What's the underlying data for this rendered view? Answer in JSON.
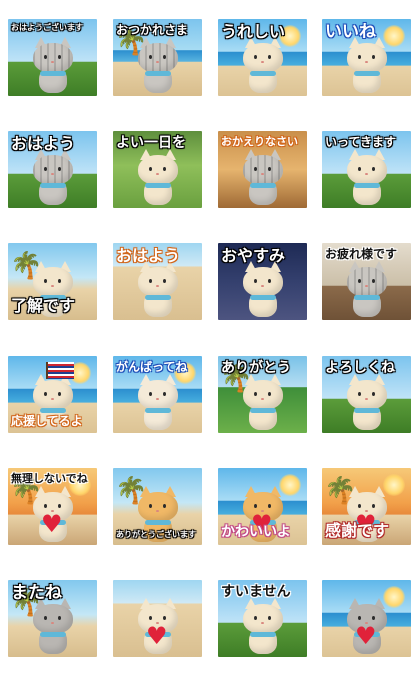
{
  "stickers": [
    {
      "label": "おはようございます",
      "scene": "grass",
      "cat": "gray-tabby",
      "style": "w"
    },
    {
      "label": "おつかれさま",
      "scene": "beach",
      "cat": "gray-tabby",
      "style": "w"
    },
    {
      "label": "うれしい",
      "scene": "sea",
      "cat": "cream",
      "style": "w"
    },
    {
      "label": "いいね",
      "scene": "sea",
      "cat": "cream",
      "style": "bl"
    },
    {
      "label": "おはよう",
      "scene": "grass",
      "cat": "gray-tabby",
      "style": "w"
    },
    {
      "label": "よい一日を",
      "scene": "garden",
      "cat": "cream",
      "style": "w"
    },
    {
      "label": "おかえりなさい",
      "scene": "house",
      "cat": "gray-tabby",
      "style": "o"
    },
    {
      "label": "いってきます",
      "scene": "grass",
      "cat": "cream",
      "style": "w"
    },
    {
      "label": "了解です",
      "scene": "palm",
      "cat": "cream",
      "style": "w"
    },
    {
      "label": "おはよう",
      "scene": "sand",
      "cat": "cream",
      "style": "o"
    },
    {
      "label": "おやすみ",
      "scene": "night",
      "cat": "cream",
      "style": "w"
    },
    {
      "label": "お疲れ様です",
      "scene": "cafe",
      "cat": "gray-tabby",
      "style": "b"
    },
    {
      "label": "応援してるよ",
      "scene": "sea",
      "cat": "cream",
      "style": "o"
    },
    {
      "label": "がんばってね",
      "scene": "sea",
      "cat": "calico",
      "style": "bl"
    },
    {
      "label": "ありがとう",
      "scene": "tropical",
      "cat": "cream",
      "style": "w"
    },
    {
      "label": "よろしくね",
      "scene": "grass",
      "cat": "cream",
      "style": "w"
    },
    {
      "label": "無理しないでね",
      "scene": "sunset",
      "cat": "cream",
      "style": "b"
    },
    {
      "label": "ありがとうございます",
      "scene": "palm",
      "cat": "orange",
      "style": "w"
    },
    {
      "label": "かわいいよ",
      "scene": "sea",
      "cat": "orange",
      "style": "pk"
    },
    {
      "label": "感謝です",
      "scene": "sunset",
      "cat": "cream",
      "style": "r"
    },
    {
      "label": "またね",
      "scene": "palm",
      "cat": "gray",
      "style": "w"
    },
    {
      "label": "",
      "scene": "sand",
      "cat": "cream",
      "style": "w"
    },
    {
      "label": "すいません",
      "scene": "grass",
      "cat": "cream",
      "style": "b"
    },
    {
      "label": "",
      "scene": "sea",
      "cat": "gray",
      "style": "w"
    }
  ],
  "colors": {
    "sky": "#7cc4ee",
    "sea": "#2c8fcf",
    "sand": "#e9d3a8",
    "grass": "#5b9c3a",
    "night": "#1e2a55",
    "sunset": "#f2a14a",
    "cream_cat": "#f3e6cc",
    "gray_cat": "#b9b6b2",
    "orange_cat": "#f0b866"
  }
}
